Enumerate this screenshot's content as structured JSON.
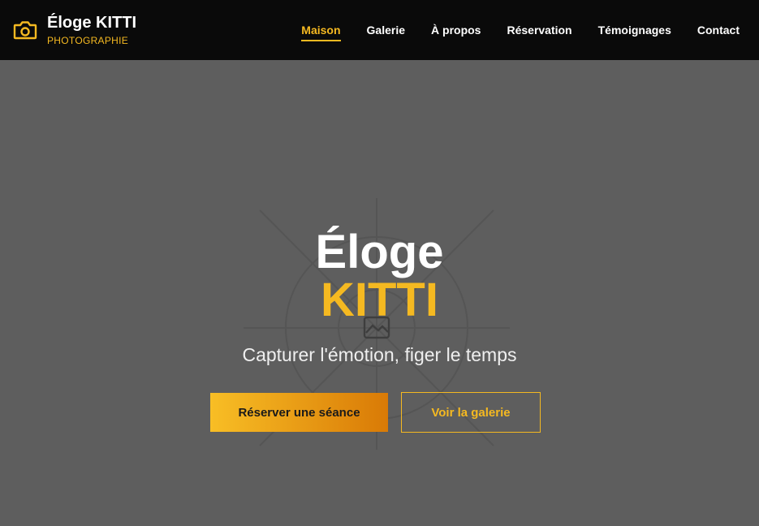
{
  "header": {
    "brand_name": "Éloge KITTI",
    "brand_subtitle": "PHOTOGRAPHIE",
    "brand_icon": "camera-icon",
    "nav": [
      {
        "label": "Maison",
        "active": true
      },
      {
        "label": "Galerie",
        "active": false
      },
      {
        "label": "À propos",
        "active": false
      },
      {
        "label": "Réservation",
        "active": false
      },
      {
        "label": "Témoignages",
        "active": false
      },
      {
        "label": "Contact",
        "active": false
      }
    ]
  },
  "hero": {
    "title_line1": "Éloge",
    "title_line2": "KITTI",
    "tagline": "Capturer l'émotion, figer le temps",
    "primary_button": "Réserver une séance",
    "secondary_button": "Voir la galerie",
    "center_icon": "image-placeholder-icon"
  },
  "colors": {
    "accent": "#f5b921",
    "navbar_bg": "#0a0a0a",
    "hero_bg": "#5e5e5e",
    "gradient_start": "#f8be25",
    "gradient_end": "#d97a06"
  }
}
